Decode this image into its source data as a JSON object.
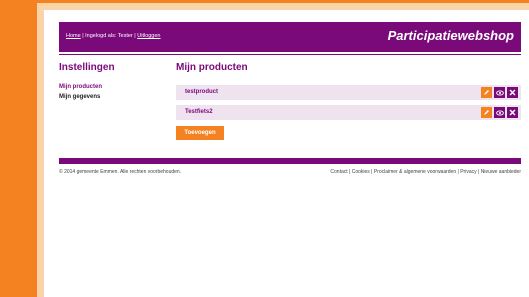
{
  "header": {
    "nav_home": "Home",
    "nav_logged_in": " | Ingelogd als: Tester | ",
    "nav_logout": "Uitloggen",
    "site_title": "Participatiewebshop"
  },
  "sidebar": {
    "title": "Instellingen",
    "items": [
      {
        "label": "Mijn producten"
      },
      {
        "label": "Mijn gegevens"
      }
    ]
  },
  "main": {
    "title": "Mijn producten",
    "products": [
      {
        "name": "testproduct"
      },
      {
        "name": "Testfiets2"
      }
    ],
    "add_label": "Toevoegen"
  },
  "footer": {
    "copyright": "© 2014 gemeente Emmen. Alle rechten voorbehouden.",
    "links": [
      "Contact",
      "Cookies",
      "Proclaimer & algemene voorwaarden",
      "Privacy",
      "Nieuwe aanbieder"
    ],
    "separator": " | "
  },
  "icons": {
    "edit": "pencil-icon",
    "view": "eye-icon",
    "delete": "close-icon"
  },
  "colors": {
    "brand_purple": "#7a0a7a",
    "accent_orange": "#f58220",
    "row_bg": "#f0e3f0"
  }
}
